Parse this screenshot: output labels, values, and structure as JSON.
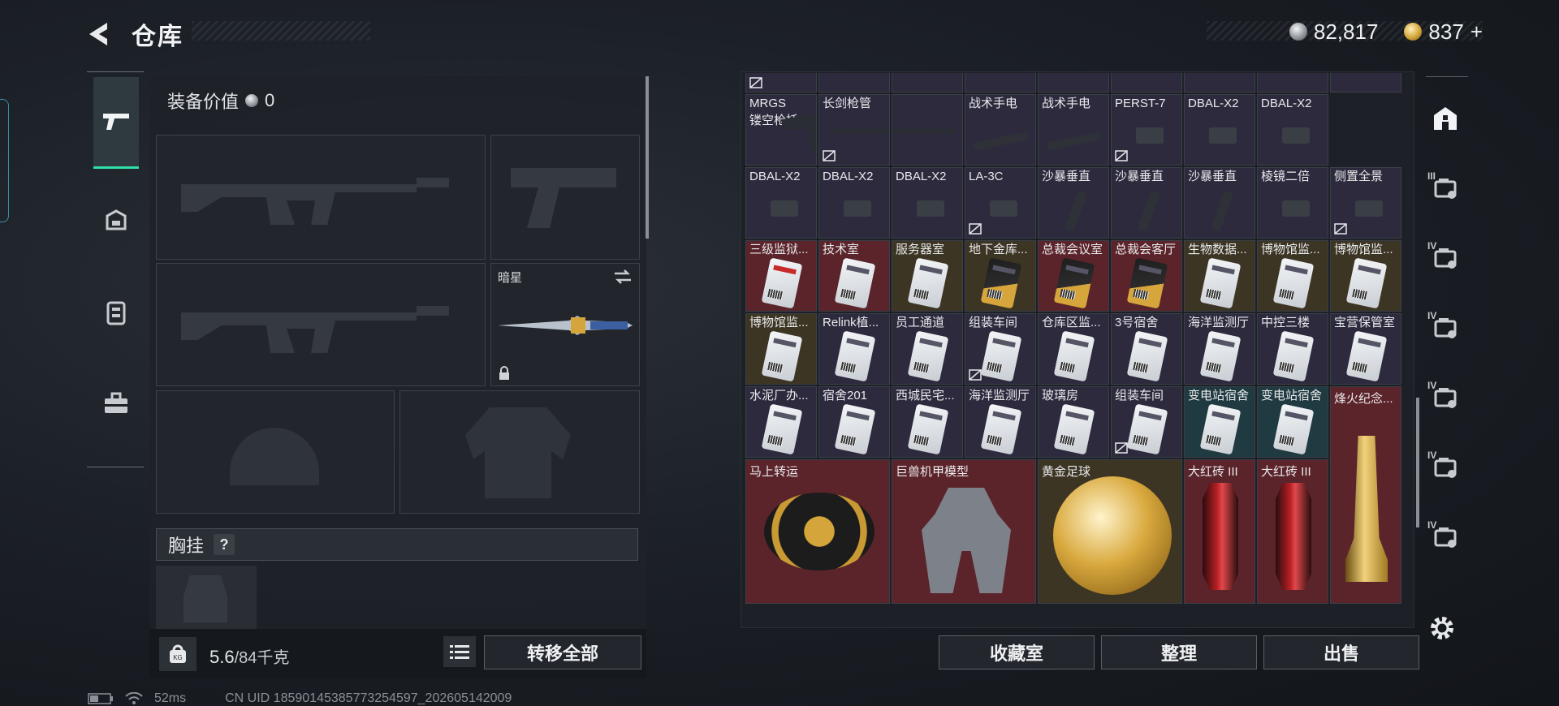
{
  "header": {
    "title": "仓库",
    "currency_silver": "82,817",
    "currency_gold": "837",
    "plus": "+"
  },
  "left_nav": {
    "items": [
      "weapons-icon",
      "backpack-icon",
      "rig-icon",
      "toolbox-icon"
    ]
  },
  "loadout": {
    "equip_value_label": "装备价值",
    "equip_value": "0",
    "melee_label": "暗星",
    "vest_label": "胸挂",
    "help": "?",
    "weight_value": "5.6",
    "weight_unit": "/84千克",
    "transfer_all": "转移全部"
  },
  "stash": {
    "rows": [
      [
        {
          "name": "MRGS",
          "name2": "镂空枪托",
          "bg": "purple",
          "kind": "stock"
        },
        {
          "name": "长剑枪管",
          "bg": "purple",
          "kind": "barrel",
          "noshare": true
        },
        {
          "name": "",
          "bg": "purple",
          "kind": "barrel-cont"
        },
        {
          "name": "战术手电",
          "bg": "purple",
          "kind": "tube"
        },
        {
          "name": "战术手电",
          "bg": "purple",
          "kind": "tube"
        },
        {
          "name": "PERST-7",
          "bg": "purple",
          "kind": "scope",
          "noshare": true
        },
        {
          "name": "DBAL-X2",
          "bg": "purple",
          "kind": "scope"
        },
        {
          "name": "DBAL-X2",
          "bg": "purple",
          "kind": "scope"
        }
      ],
      [
        {
          "name": "DBAL-X2",
          "bg": "purple",
          "kind": "scope"
        },
        {
          "name": "DBAL-X2",
          "bg": "purple",
          "kind": "scope"
        },
        {
          "name": "DBAL-X2",
          "bg": "purple",
          "kind": "scope"
        },
        {
          "name": "LA-3C",
          "bg": "purple",
          "kind": "scope",
          "noshare": true
        },
        {
          "name": "沙暴垂直",
          "bg": "purple",
          "kind": "vtube"
        },
        {
          "name": "沙暴垂直",
          "bg": "purple",
          "kind": "vtube"
        },
        {
          "name": "沙暴垂直",
          "bg": "purple",
          "kind": "vtube"
        },
        {
          "name": "棱镜二倍",
          "bg": "purple",
          "kind": "scope"
        }
      ],
      [
        {
          "name": "三级监狱...",
          "bg": "red",
          "kind": "card",
          "card": "redc"
        },
        {
          "name": "技术室",
          "bg": "red",
          "kind": "card"
        },
        {
          "name": "服务器室",
          "bg": "gold-bg",
          "kind": "card"
        },
        {
          "name": "地下金库...",
          "bg": "gold-bg",
          "kind": "card",
          "card": "goldc"
        },
        {
          "name": "总裁会议室",
          "bg": "red",
          "kind": "card",
          "card": "goldc"
        },
        {
          "name": "总裁会客厅",
          "bg": "red",
          "kind": "card",
          "card": "goldc"
        },
        {
          "name": "生物数据...",
          "bg": "gold-bg",
          "kind": "card"
        },
        {
          "name": "博物馆监...",
          "bg": "gold-bg",
          "kind": "card"
        }
      ],
      [
        {
          "name": "博物馆监...",
          "bg": "gold-bg",
          "kind": "card"
        },
        {
          "name": "Relink植...",
          "bg": "purple",
          "kind": "card"
        },
        {
          "name": "员工通道",
          "bg": "purple",
          "kind": "card"
        },
        {
          "name": "组装车间",
          "bg": "purple",
          "kind": "card",
          "noshare": true
        },
        {
          "name": "仓库区监...",
          "bg": "purple",
          "kind": "card"
        },
        {
          "name": "3号宿舍",
          "bg": "purple",
          "kind": "card"
        },
        {
          "name": "海洋监测厅",
          "bg": "purple",
          "kind": "card"
        },
        {
          "name": "中控三楼",
          "bg": "purple",
          "kind": "card"
        }
      ],
      [
        {
          "name": "水泥厂办...",
          "bg": "purple",
          "kind": "card"
        },
        {
          "name": "宿舍201",
          "bg": "purple",
          "kind": "card"
        },
        {
          "name": "西城民宅...",
          "bg": "purple",
          "kind": "card"
        },
        {
          "name": "海洋监测厅",
          "bg": "purple",
          "kind": "card"
        },
        {
          "name": "玻璃房",
          "bg": "purple",
          "kind": "card"
        },
        {
          "name": "组装车间",
          "bg": "purple",
          "kind": "card",
          "noshare": true
        },
        {
          "name": "变电站宿舍",
          "bg": "teal",
          "kind": "card"
        },
        {
          "name": "变电站宿舍",
          "bg": "teal",
          "kind": "card"
        }
      ]
    ],
    "col9_top": [
      {
        "name": "侧置全景",
        "bg": "purple",
        "kind": "scope",
        "noshare": true
      },
      {
        "name": "博物馆监...",
        "bg": "gold-bg",
        "kind": "card"
      },
      {
        "name": "宝营保管室",
        "bg": "purple",
        "kind": "card"
      }
    ],
    "big_items": [
      {
        "name": "马上转运",
        "kind": "disc"
      },
      {
        "name": "巨兽机甲模型",
        "kind": "mech"
      },
      {
        "name": "黄金足球",
        "kind": "ball"
      }
    ],
    "tall_items": [
      {
        "name": "大红砖 III",
        "kind": "brick"
      },
      {
        "name": "大红砖 III",
        "kind": "brick"
      },
      {
        "name": "烽火纪念...",
        "kind": "trophy"
      }
    ],
    "buttons": {
      "collection": "收藏室",
      "sort": "整理",
      "sell": "出售"
    }
  },
  "right_nav": {
    "items": [
      {
        "roman": "",
        "icon": "home-storage-icon"
      },
      {
        "roman": "III",
        "icon": "storage-expand-icon"
      },
      {
        "roman": "IV",
        "icon": "storage-folder-icon"
      },
      {
        "roman": "IV",
        "icon": "storage-gear-icon"
      },
      {
        "roman": "IV",
        "icon": "storage-plus-icon"
      },
      {
        "roman": "IV",
        "icon": "storage-camera-icon"
      },
      {
        "roman": "IV",
        "icon": "storage-box-icon"
      }
    ]
  },
  "status": {
    "ping": "52ms",
    "uid": "CN UID 185901453857732545​97_202605142009"
  },
  "colors": {
    "accent": "#2fe0a8",
    "red_cell": "#5b242a",
    "purple_cell": "#2d2a3e"
  }
}
